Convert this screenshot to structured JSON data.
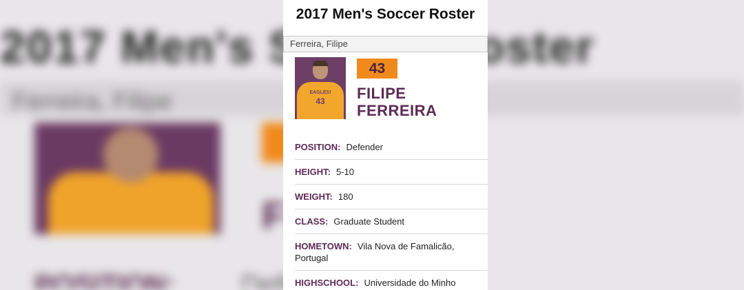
{
  "page": {
    "title": "2017 Men's Soccer Roster",
    "player_select_value": "Ferreira, Filipe"
  },
  "player": {
    "number": "43",
    "first_name": "FILIPE",
    "last_name": "FERREIRA",
    "jersey_text": "EAGLES!",
    "jersey_number": "43"
  },
  "details": [
    {
      "label": "POSITION:",
      "value": "Defender"
    },
    {
      "label": "HEIGHT:",
      "value": "5-10"
    },
    {
      "label": "WEIGHT:",
      "value": "180"
    },
    {
      "label": "CLASS:",
      "value": "Graduate Student"
    },
    {
      "label": "HOMETOWN:",
      "value": "Vila Nova de Famalicão, Portugal"
    },
    {
      "label": "HIGHSCHOOL:",
      "value": "Universidade do Minho"
    }
  ],
  "colors": {
    "accent_purple": "#5d2a56",
    "number_orange": "#f08a1c",
    "jersey_gold": "#f2a62b"
  }
}
